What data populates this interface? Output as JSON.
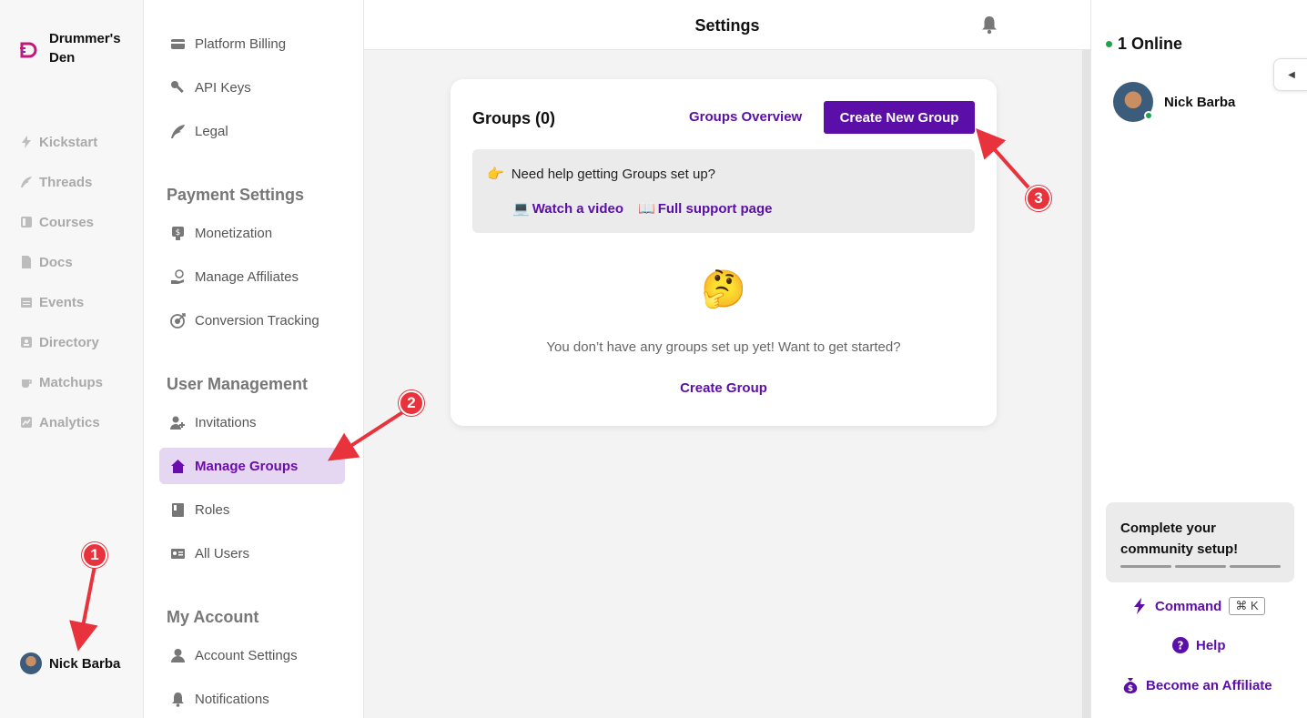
{
  "app": {
    "brand_name": "Drummer's Den"
  },
  "leftnav": {
    "items": [
      {
        "label": "Kickstart",
        "icon": "bolt-icon"
      },
      {
        "label": "Threads",
        "icon": "feather-icon"
      },
      {
        "label": "Courses",
        "icon": "book-icon"
      },
      {
        "label": "Docs",
        "icon": "doc-icon"
      },
      {
        "label": "Events",
        "icon": "calendar-icon"
      },
      {
        "label": "Directory",
        "icon": "contact-icon"
      },
      {
        "label": "Matchups",
        "icon": "cup-icon"
      },
      {
        "label": "Analytics",
        "icon": "chart-icon"
      }
    ],
    "user_name": "Nick Barba"
  },
  "settings_menu": {
    "top_items": [
      {
        "label": "Platform Billing"
      },
      {
        "label": "API Keys"
      },
      {
        "label": "Legal"
      }
    ],
    "payment_heading": "Payment Settings",
    "payment_items": [
      {
        "label": "Monetization"
      },
      {
        "label": "Manage Affiliates"
      },
      {
        "label": "Conversion Tracking"
      }
    ],
    "user_mgmt_heading": "User Management",
    "user_mgmt_items": [
      {
        "label": "Invitations"
      },
      {
        "label": "Manage Groups"
      },
      {
        "label": "Roles"
      },
      {
        "label": "All Users"
      }
    ],
    "account_heading": "My Account",
    "account_items": [
      {
        "label": "Account Settings"
      },
      {
        "label": "Notifications"
      }
    ]
  },
  "main": {
    "title": "Settings",
    "card": {
      "title": "Groups (0)",
      "overview_link": "Groups Overview",
      "create_button": "Create New Group",
      "help_emoji": "👉",
      "help_text": "Need help getting Groups set up?",
      "watch_emoji": "💻",
      "watch_video": "Watch a video",
      "support_emoji": "📖",
      "support_page": "Full support page",
      "empty_emoji": "🤔",
      "empty_text": "You don’t have any groups set up yet! Want to get started?",
      "create_group_link": "Create Group"
    }
  },
  "rightpanel": {
    "online_count": "1 Online",
    "member_name": "Nick Barba",
    "setup_title": "Complete your community setup!",
    "command_label": "Command",
    "command_shortcut": "⌘ K",
    "help_label": "Help",
    "affiliate_label": "Become an Affiliate"
  },
  "annotations": {
    "m1": "1",
    "m2": "2",
    "m3": "3"
  },
  "colors": {
    "accent": "#5b0fa8",
    "active_bg": "#e5d7f2",
    "online": "#1fa34a",
    "marker": "#e8333d"
  }
}
